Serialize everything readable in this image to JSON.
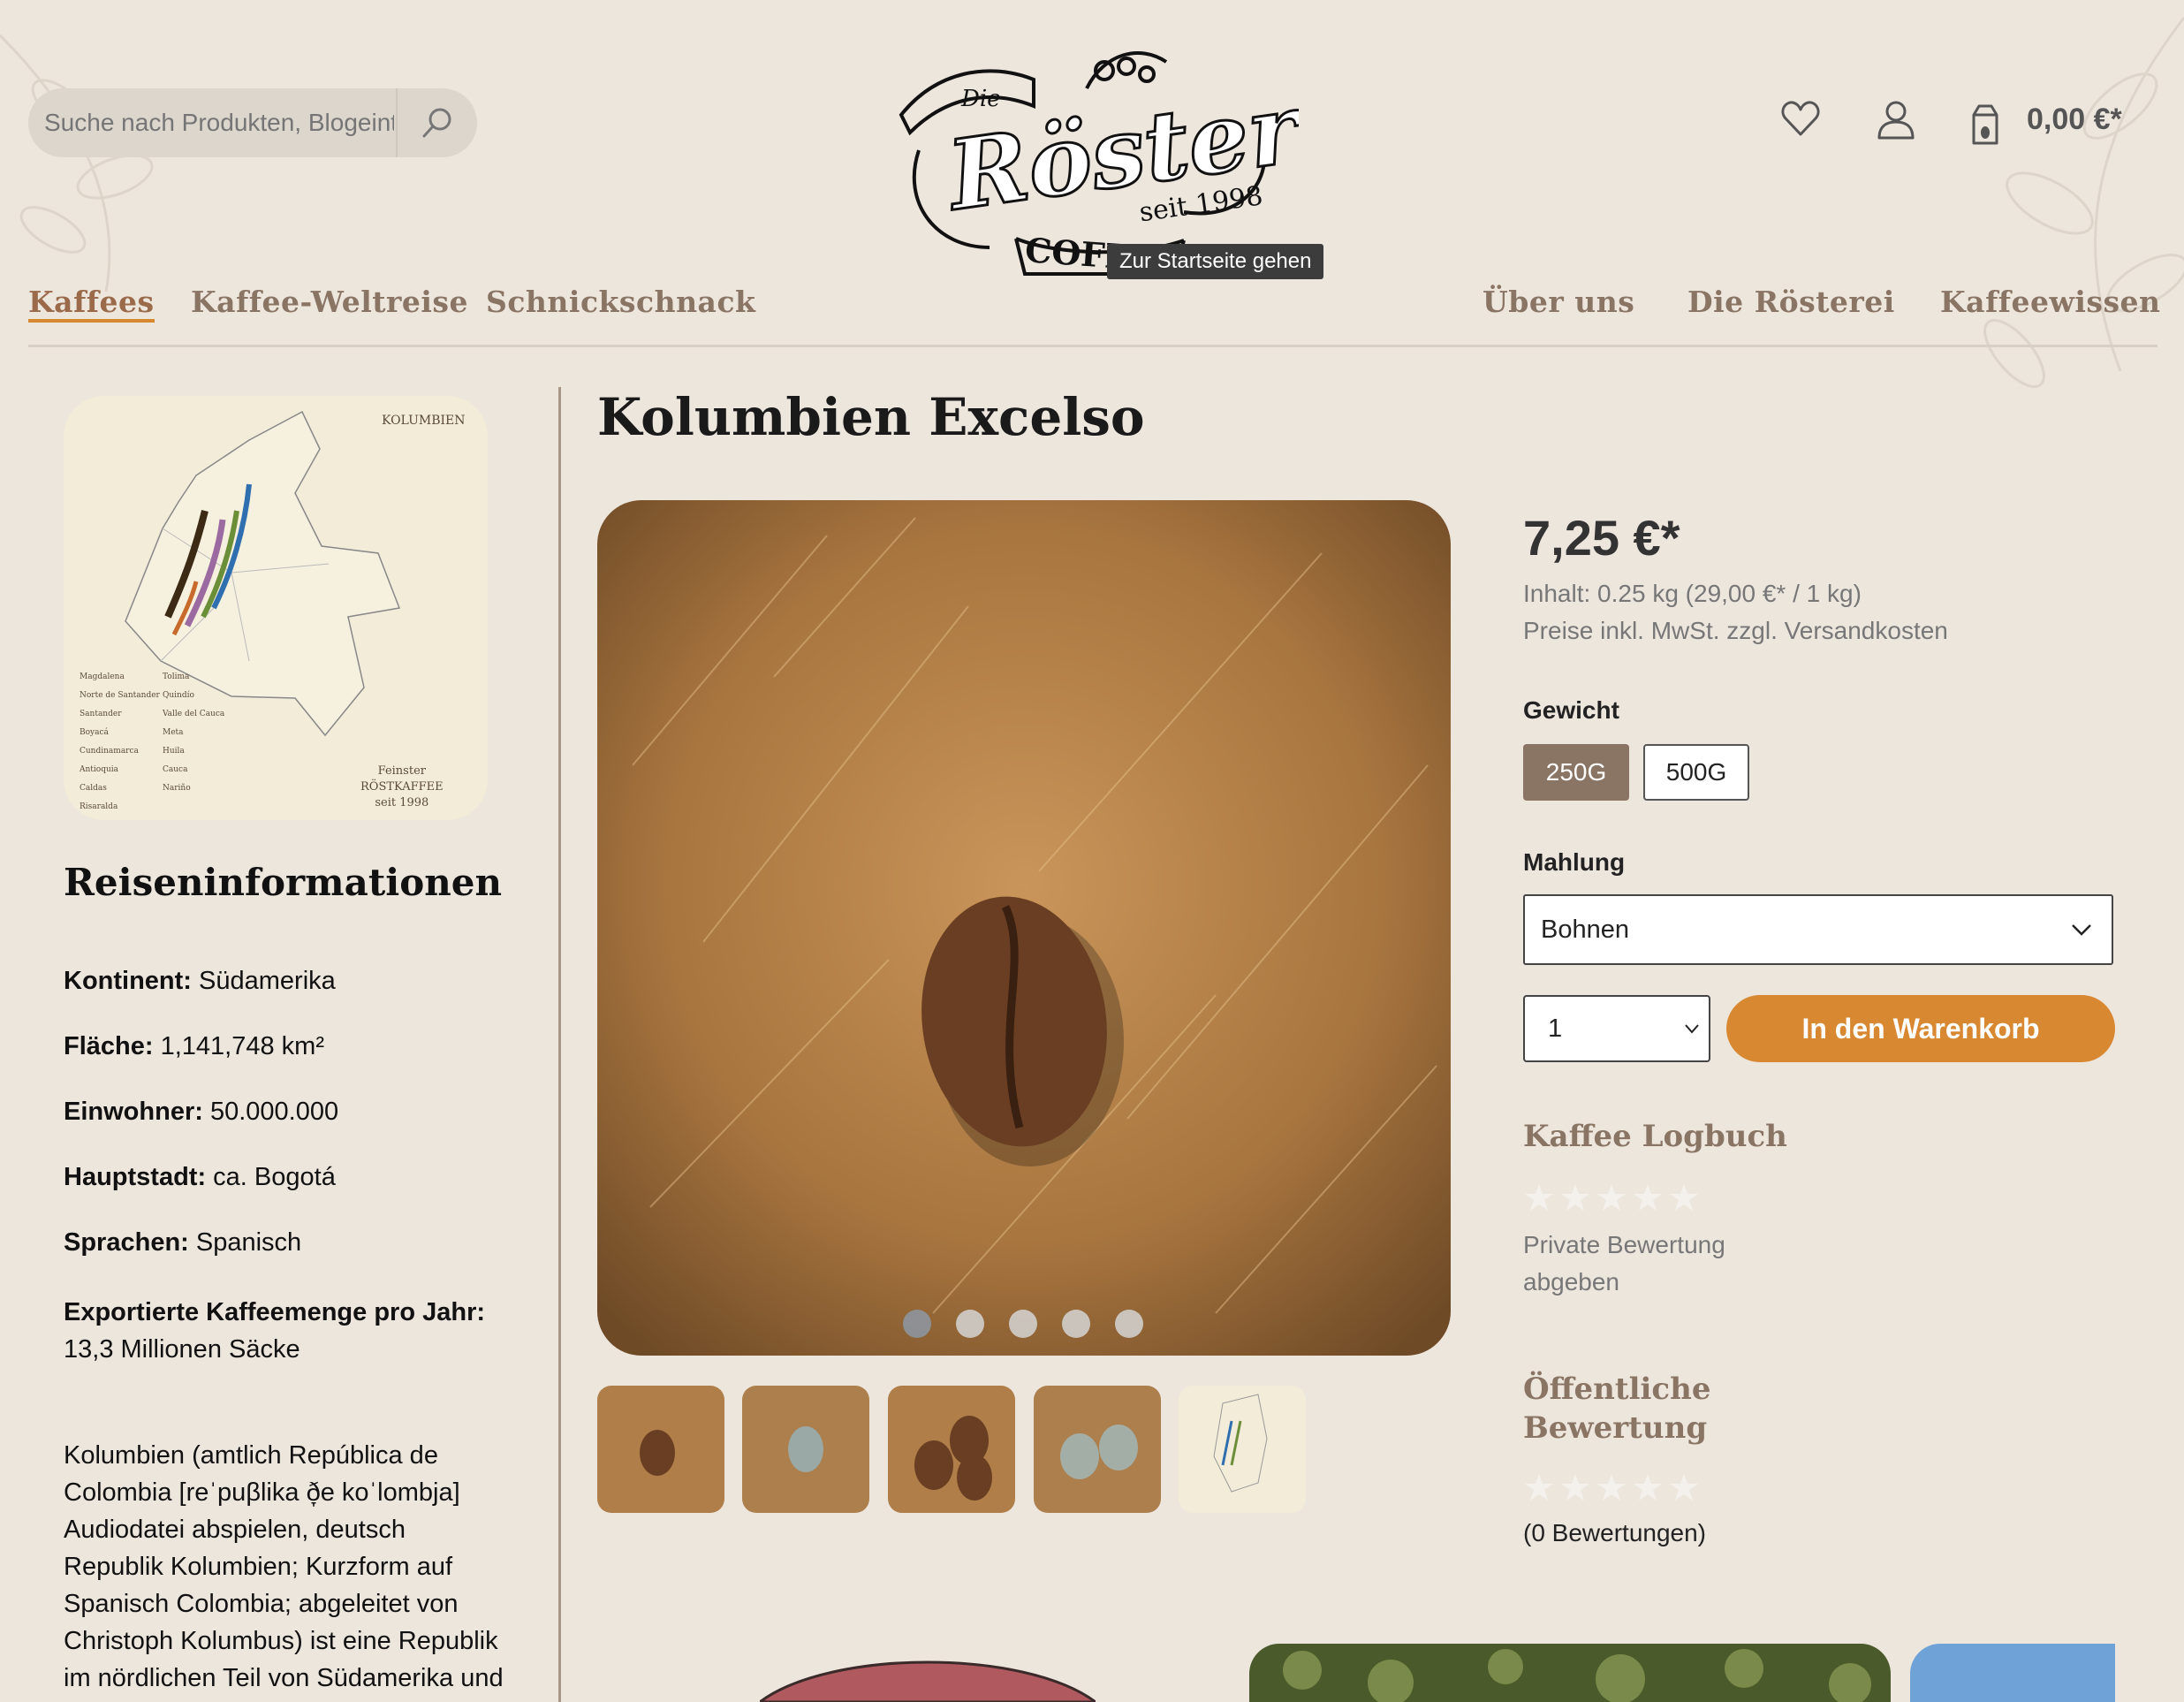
{
  "header": {
    "search_placeholder": "Suche nach Produkten, Blogeinträgen...",
    "tooltip": "Zur Startseite gehen",
    "cart_total": "0,00 €*",
    "icons": [
      "search-icon",
      "heart-icon",
      "user-icon",
      "cart-icon"
    ]
  },
  "logo": {
    "top": "Die",
    "name": "Rösterei",
    "since": "seit 1998",
    "brand": "COFFEUM"
  },
  "nav": {
    "left": [
      "Kaffees",
      "Kaffee-Weltreise",
      "Schnickschnack"
    ],
    "right": [
      "Über uns",
      "Die Rösterei",
      "Kaffeewissen"
    ],
    "active": "Kaffees"
  },
  "sidebar": {
    "map": {
      "title": "KOLUMBIEN",
      "legend_left": [
        "Magdalena",
        "Norte de Santander",
        "Santander",
        "Boyacá",
        "Cundinamarca",
        "Antioquia",
        "Caldas",
        "Risaralda"
      ],
      "legend_right": [
        "Tolima",
        "Quindío",
        "Valle del Cauca",
        "Meta",
        "Huila",
        "Cauca",
        "Nariño"
      ],
      "brand_lines": [
        "Feinster",
        "RÖSTKAFFEE",
        "seit 1998"
      ]
    },
    "title": "Reiseninformationen",
    "facts": [
      {
        "label": "Kontinent:",
        "value": "Südamerika"
      },
      {
        "label": "Fläche:",
        "value": " 1,141,748 km²"
      },
      {
        "label": "Einwohner:",
        "value": "50.000.000"
      },
      {
        "label": "Hauptstadt:",
        "value": "ca. Bogotá"
      },
      {
        "label": "Sprachen:",
        "value": "Spanisch"
      },
      {
        "label": "Exportierte Kaffeemenge pro Jahr:",
        "value": "13,3 Millionen Säcke"
      }
    ],
    "description": "Kolumbien (amtlich República de Colombia [reˈpuβlika ð̞e koˈlombja] Audiodatei abspielen, deutsch Republik Kolumbien; Kurzform auf Spanisch Colombia; abgeleitet von Christoph Kolumbus) ist eine Republik im nördlichen Teil von Südamerika und"
  },
  "product": {
    "title": "Kolumbien Excelso",
    "price": "7,25 €*",
    "content": "Inhalt: 0.25 kg (29,00 €* / 1 kg)",
    "tax": "Preise inkl. MwSt. zzgl. Versandkosten",
    "weight_label": "Gewicht",
    "weights": [
      "250G",
      "500G"
    ],
    "weight_selected": "250G",
    "grind_label": "Mahlung",
    "grind_value": "Bohnen",
    "qty": "1",
    "add_to_cart": "In den Warenkorb",
    "logbook_title": "Kaffee Logbuch",
    "private_rating": "Private Bewertung abgeben",
    "public_title": "Öffentliche Bewertung",
    "review_count": "(0 Bewertungen)",
    "gallery_slides": 5,
    "gallery_active": 1
  },
  "colors": {
    "accent": "#d98832",
    "nav": "#8a7565",
    "selected_option": "#8a7565",
    "background": "#ede6dd"
  }
}
